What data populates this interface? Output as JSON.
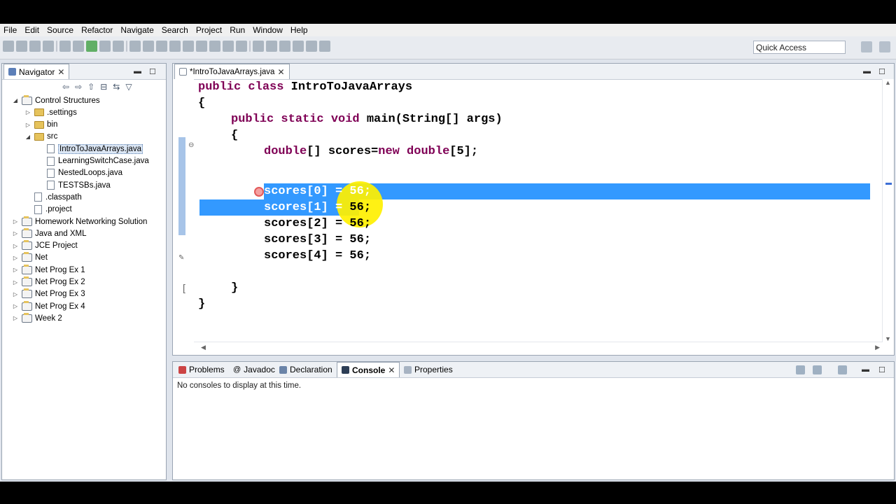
{
  "menu": [
    "File",
    "Edit",
    "Source",
    "Refactor",
    "Navigate",
    "Search",
    "Project",
    "Run",
    "Window",
    "Help"
  ],
  "quick_access": "Quick Access",
  "navigator": {
    "title": "Navigator",
    "tree": [
      {
        "label": "Control Structures",
        "depth": 0,
        "kind": "project",
        "twisty": "open"
      },
      {
        "label": ".settings",
        "depth": 1,
        "kind": "folder",
        "twisty": "closed"
      },
      {
        "label": "bin",
        "depth": 1,
        "kind": "folder",
        "twisty": "closed"
      },
      {
        "label": "src",
        "depth": 1,
        "kind": "folder",
        "twisty": "open"
      },
      {
        "label": "IntroToJavaArrays.java",
        "depth": 2,
        "kind": "file",
        "selected": true
      },
      {
        "label": "LearningSwitchCase.java",
        "depth": 2,
        "kind": "file"
      },
      {
        "label": "NestedLoops.java",
        "depth": 2,
        "kind": "file"
      },
      {
        "label": "TESTSBs.java",
        "depth": 2,
        "kind": "file"
      },
      {
        "label": ".classpath",
        "depth": 1,
        "kind": "file"
      },
      {
        "label": ".project",
        "depth": 1,
        "kind": "file"
      },
      {
        "label": "Homework Networking Solution",
        "depth": 0,
        "kind": "project",
        "twisty": "closed"
      },
      {
        "label": "Java and XML",
        "depth": 0,
        "kind": "project",
        "twisty": "closed"
      },
      {
        "label": "JCE Project",
        "depth": 0,
        "kind": "project",
        "twisty": "closed"
      },
      {
        "label": "Net",
        "depth": 0,
        "kind": "project",
        "twisty": "closed"
      },
      {
        "label": "Net Prog Ex 1",
        "depth": 0,
        "kind": "project",
        "twisty": "closed"
      },
      {
        "label": "Net Prog Ex 2",
        "depth": 0,
        "kind": "project",
        "twisty": "closed"
      },
      {
        "label": "Net Prog Ex 3",
        "depth": 0,
        "kind": "project",
        "twisty": "closed"
      },
      {
        "label": "Net Prog Ex 4",
        "depth": 0,
        "kind": "project",
        "twisty": "closed"
      },
      {
        "label": "Week 2",
        "depth": 0,
        "kind": "project",
        "twisty": "closed"
      }
    ]
  },
  "editor": {
    "tab_label": "*IntroToJavaArrays.java",
    "lines": {
      "l1_kw": "public class ",
      "l1_rest": "IntroToJavaArrays",
      "l2": "{",
      "l3_kw": "public static void ",
      "l3_rest": "main(String[] args)",
      "l4": "{",
      "l5_kw1": "double",
      "l5_mid": "[] scores=",
      "l5_kw2": "new double",
      "l5_rest": "[5];",
      "l6": "scores[0] = 56;",
      "l7_a": "scores[1] = ",
      "l7_b": "56",
      "l7_c": ";",
      "l8": "scores[2] = 56;",
      "l9": "scores[3] = 56;",
      "l10": "scores[4] = 56;",
      "l11": "}",
      "l12": "}"
    }
  },
  "bottom": {
    "tabs": [
      "Problems",
      "Javadoc",
      "Declaration",
      "Console",
      "Properties"
    ],
    "active_tab": "Console",
    "console_message": "No consoles to display at this time."
  },
  "colors": {
    "keyword": "#7f0055",
    "selection": "#3399ff",
    "highlight": "#fff000"
  }
}
